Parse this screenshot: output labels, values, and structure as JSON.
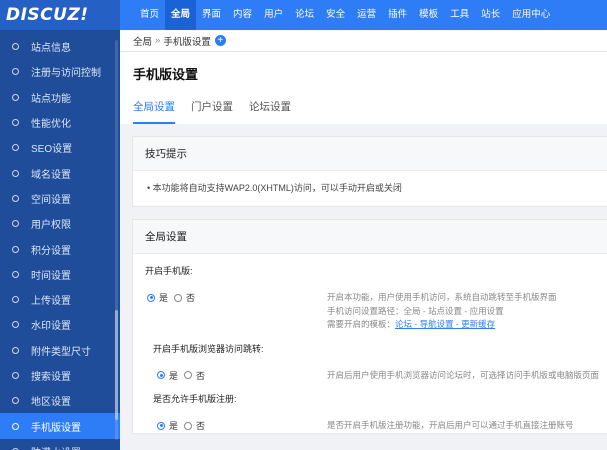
{
  "logo": "DISCUZ!",
  "sidebar": {
    "items": [
      "站点信息",
      "注册与访问控制",
      "站点功能",
      "性能优化",
      "SEO设置",
      "域名设置",
      "空间设置",
      "用户权限",
      "积分设置",
      "时间设置",
      "上传设置",
      "水印设置",
      "附件类型尺寸",
      "搜索设置",
      "地区设置",
      "手机版设置",
      "防灌水设置"
    ],
    "active_index": 15
  },
  "topnav": {
    "items": [
      "首页",
      "全局",
      "界面",
      "内容",
      "用户",
      "论坛",
      "安全",
      "运营",
      "插件",
      "模板",
      "工具",
      "站长",
      "应用中心"
    ],
    "active_index": 1
  },
  "breadcrumb": {
    "root": "全局",
    "sep": "»",
    "current": "手机版设置",
    "add": "+"
  },
  "page": {
    "title": "手机版设置",
    "tabs": [
      "全局设置",
      "门户设置",
      "论坛设置"
    ],
    "active_tab": 0
  },
  "tips": {
    "title": "技巧提示",
    "text": "• 本功能将自动支持WAP2.0(XHTML)访问，可以手动开启或关闭"
  },
  "settings": {
    "title": "全局设置",
    "yes": "是",
    "no": "否",
    "fields": [
      {
        "label": "开启手机版:",
        "desc1": "开启本功能，用户使用手机访问，系统自动跳转至手机版界面",
        "desc2": "手机访问设置路径：全局 - 站点设置 - 应用设置",
        "desc3_prefix": "需要开启的模板：",
        "desc3_links": "论坛 - 导航设置 - 更新缓存"
      },
      {
        "label": "开启手机版浏览器访问跳转:",
        "desc1": "开启后用户使用手机浏览器访问论坛时，可选择访问手机版或电脑版页面"
      },
      {
        "label": "是否允许手机版注册:",
        "desc1": "是否开启手机版注册功能，开启后用户可以通过手机直接注册账号"
      }
    ]
  }
}
